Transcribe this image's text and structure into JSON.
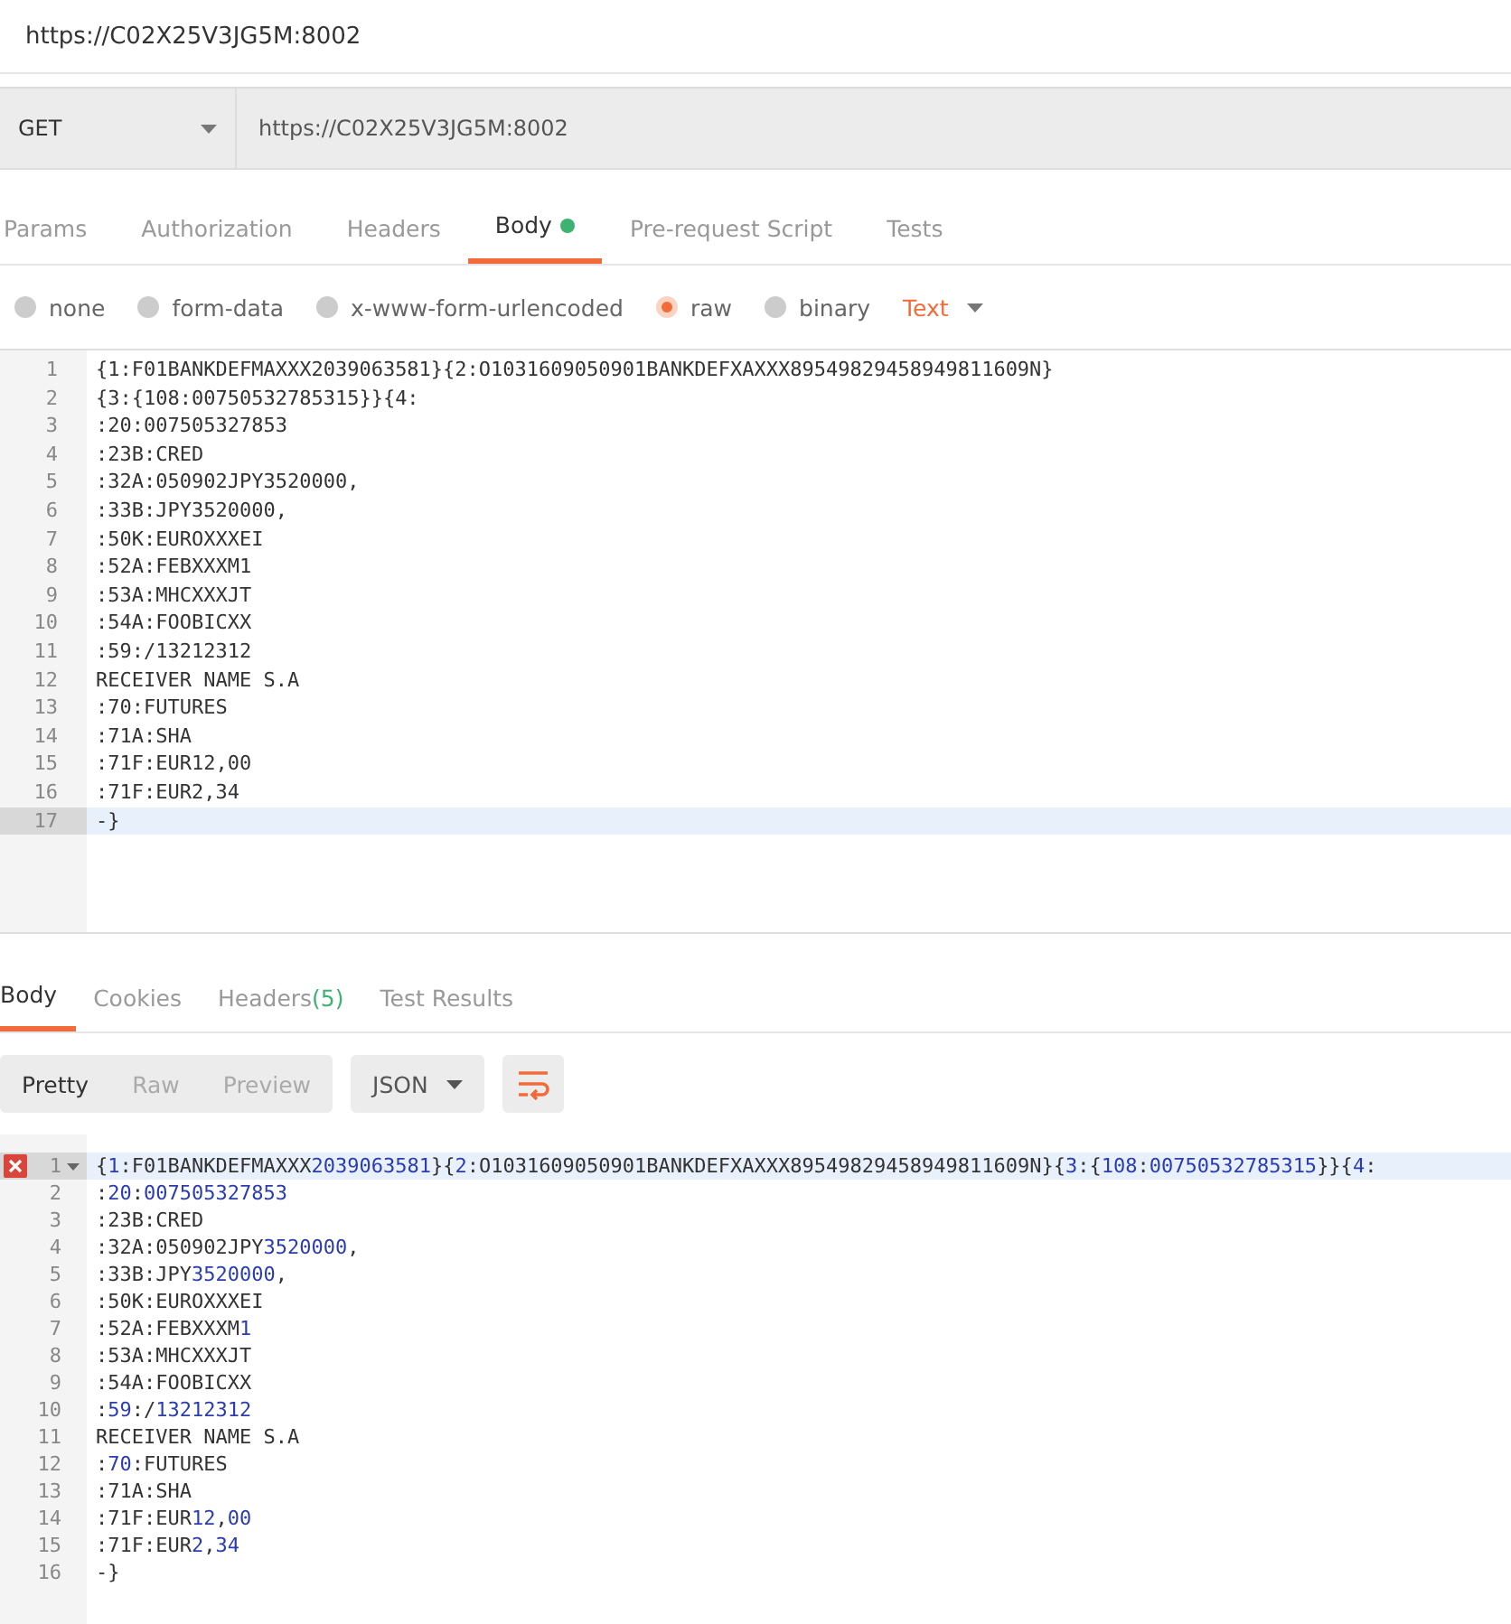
{
  "title": "https://C02X25V3JG5M:8002",
  "request": {
    "method": "GET",
    "url": "https://C02X25V3JG5M:8002"
  },
  "request_tabs": [
    {
      "label": "Params",
      "selected": false,
      "dot": false
    },
    {
      "label": "Authorization",
      "selected": false,
      "dot": false
    },
    {
      "label": "Headers",
      "selected": false,
      "dot": false
    },
    {
      "label": "Body",
      "selected": true,
      "dot": true
    },
    {
      "label": "Pre-request Script",
      "selected": false,
      "dot": false
    },
    {
      "label": "Tests",
      "selected": false,
      "dot": false
    }
  ],
  "body_types": [
    {
      "label": "none",
      "selected": false
    },
    {
      "label": "form-data",
      "selected": false
    },
    {
      "label": "x-www-form-urlencoded",
      "selected": false
    },
    {
      "label": "raw",
      "selected": true
    },
    {
      "label": "binary",
      "selected": false
    }
  ],
  "format": "Text",
  "request_body": {
    "lines": [
      {
        "n": "1",
        "text": "{1:F01BANKDEFMAXXX2039063581}{2:O1031609050901BANKDEFXAXXX89549829458949811609N}",
        "active": false
      },
      {
        "n": "2",
        "text": "{3:{108:00750532785315}}{4:",
        "active": false
      },
      {
        "n": "3",
        "text": ":20:007505327853",
        "active": false
      },
      {
        "n": "4",
        "text": ":23B:CRED",
        "active": false
      },
      {
        "n": "5",
        "text": ":32A:050902JPY3520000,",
        "active": false
      },
      {
        "n": "6",
        "text": ":33B:JPY3520000,",
        "active": false
      },
      {
        "n": "7",
        "text": ":50K:EUROXXXEI",
        "active": false
      },
      {
        "n": "8",
        "text": ":52A:FEBXXXM1",
        "active": false
      },
      {
        "n": "9",
        "text": ":53A:MHCXXXJT",
        "active": false
      },
      {
        "n": "10",
        "text": ":54A:FOOBICXX",
        "active": false
      },
      {
        "n": "11",
        "text": ":59:/13212312",
        "active": false
      },
      {
        "n": "12",
        "text": "RECEIVER NAME S.A",
        "active": false
      },
      {
        "n": "13",
        "text": ":70:FUTURES",
        "active": false
      },
      {
        "n": "14",
        "text": ":71A:SHA",
        "active": false
      },
      {
        "n": "15",
        "text": ":71F:EUR12,00",
        "active": false
      },
      {
        "n": "16",
        "text": ":71F:EUR2,34",
        "active": false
      },
      {
        "n": "17",
        "text": "-}",
        "active": true
      }
    ]
  },
  "response_tabs": [
    {
      "label": "Body",
      "selected": true
    },
    {
      "label": "Cookies",
      "selected": false
    },
    {
      "label": "Headers",
      "count": "(5)",
      "selected": false
    },
    {
      "label": "Test Results",
      "selected": false
    }
  ],
  "view_modes": [
    {
      "label": "Pretty",
      "selected": true
    },
    {
      "label": "Raw",
      "selected": false
    },
    {
      "label": "Preview",
      "selected": false
    }
  ],
  "response_format": "JSON",
  "wrap": true,
  "response_body": {
    "lines": [
      {
        "n": "1",
        "active": true,
        "error": true,
        "foldable": true,
        "tokens": [
          {
            "t": "{",
            "kind": "plain"
          },
          {
            "t": "1",
            "kind": "number"
          },
          {
            "t": ":F01BANKDEFMAXXX",
            "kind": "plain"
          },
          {
            "t": "2039063581",
            "kind": "number"
          },
          {
            "t": "}{",
            "kind": "plain"
          },
          {
            "t": "2",
            "kind": "number"
          },
          {
            "t": ":O1031609050901BANKDEFXAXXX89549829458949811609N}{",
            "kind": "plain"
          },
          {
            "t": "3",
            "kind": "number"
          },
          {
            "t": ":{",
            "kind": "plain"
          },
          {
            "t": "108",
            "kind": "number"
          },
          {
            "t": ":",
            "kind": "plain"
          },
          {
            "t": "00750532785315",
            "kind": "number"
          },
          {
            "t": "}}{",
            "kind": "plain"
          },
          {
            "t": "4",
            "kind": "number"
          },
          {
            "t": ":",
            "kind": "plain"
          }
        ]
      },
      {
        "n": "2",
        "active": false,
        "error": false,
        "foldable": false,
        "tokens": [
          {
            "t": ":",
            "kind": "plain"
          },
          {
            "t": "20",
            "kind": "number"
          },
          {
            "t": ":",
            "kind": "plain"
          },
          {
            "t": "007505327853",
            "kind": "number"
          }
        ]
      },
      {
        "n": "3",
        "active": false,
        "error": false,
        "foldable": false,
        "tokens": [
          {
            "t": ":23B:CRED",
            "kind": "plain"
          }
        ]
      },
      {
        "n": "4",
        "active": false,
        "error": false,
        "foldable": false,
        "tokens": [
          {
            "t": ":32A:050902JPY",
            "kind": "plain"
          },
          {
            "t": "3520000",
            "kind": "number"
          },
          {
            "t": ",",
            "kind": "plain"
          }
        ]
      },
      {
        "n": "5",
        "active": false,
        "error": false,
        "foldable": false,
        "tokens": [
          {
            "t": ":33B:JPY",
            "kind": "plain"
          },
          {
            "t": "3520000",
            "kind": "number"
          },
          {
            "t": ",",
            "kind": "plain"
          }
        ]
      },
      {
        "n": "6",
        "active": false,
        "error": false,
        "foldable": false,
        "tokens": [
          {
            "t": ":50K:EUROXXXEI",
            "kind": "plain"
          }
        ]
      },
      {
        "n": "7",
        "active": false,
        "error": false,
        "foldable": false,
        "tokens": [
          {
            "t": ":52A:FEBXXXM",
            "kind": "plain"
          },
          {
            "t": "1",
            "kind": "number"
          }
        ]
      },
      {
        "n": "8",
        "active": false,
        "error": false,
        "foldable": false,
        "tokens": [
          {
            "t": ":53A:MHCXXXJT",
            "kind": "plain"
          }
        ]
      },
      {
        "n": "9",
        "active": false,
        "error": false,
        "foldable": false,
        "tokens": [
          {
            "t": ":54A:FOOBICXX",
            "kind": "plain"
          }
        ]
      },
      {
        "n": "10",
        "active": false,
        "error": false,
        "foldable": false,
        "tokens": [
          {
            "t": ":",
            "kind": "plain"
          },
          {
            "t": "59",
            "kind": "number"
          },
          {
            "t": ":/",
            "kind": "plain"
          },
          {
            "t": "13212312",
            "kind": "number"
          }
        ]
      },
      {
        "n": "11",
        "active": false,
        "error": false,
        "foldable": false,
        "tokens": [
          {
            "t": "RECEIVER NAME S.A",
            "kind": "plain"
          }
        ]
      },
      {
        "n": "12",
        "active": false,
        "error": false,
        "foldable": false,
        "tokens": [
          {
            "t": ":",
            "kind": "plain"
          },
          {
            "t": "70",
            "kind": "number"
          },
          {
            "t": ":FUTURES",
            "kind": "plain"
          }
        ]
      },
      {
        "n": "13",
        "active": false,
        "error": false,
        "foldable": false,
        "tokens": [
          {
            "t": ":71A:SHA",
            "kind": "plain"
          }
        ]
      },
      {
        "n": "14",
        "active": false,
        "error": false,
        "foldable": false,
        "tokens": [
          {
            "t": ":71F:EUR",
            "kind": "plain"
          },
          {
            "t": "12",
            "kind": "number"
          },
          {
            "t": ",",
            "kind": "plain"
          },
          {
            "t": "00",
            "kind": "number"
          }
        ]
      },
      {
        "n": "15",
        "active": false,
        "error": false,
        "foldable": false,
        "tokens": [
          {
            "t": ":71F:EUR",
            "kind": "plain"
          },
          {
            "t": "2",
            "kind": "number"
          },
          {
            "t": ",",
            "kind": "plain"
          },
          {
            "t": "34",
            "kind": "number"
          }
        ]
      },
      {
        "n": "16",
        "active": false,
        "error": false,
        "foldable": false,
        "tokens": [
          {
            "t": "-}",
            "kind": "plain"
          }
        ]
      }
    ]
  }
}
